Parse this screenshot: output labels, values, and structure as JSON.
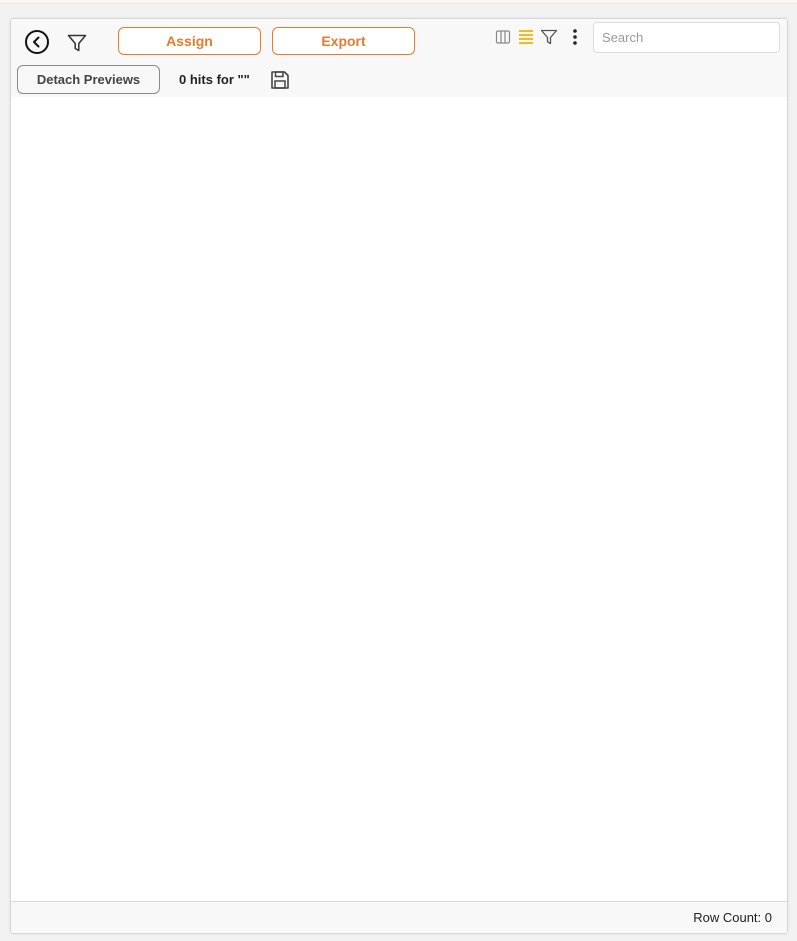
{
  "toolbar": {
    "back_icon": "arrow-left-circle-icon",
    "filter_icon": "funnel-icon",
    "assign_label": "Assign",
    "export_label": "Export",
    "columns_icon": "columns-icon",
    "list_icon": "list-icon",
    "more_icon": "vertical-ellipsis-icon",
    "search_placeholder": "Search",
    "search_value": "",
    "detach_label": "Detach Previews",
    "hits_text": "0 hits for \"\"",
    "save_icon": "floppy-disk-icon"
  },
  "footer": {
    "row_count_text": "Row Count: 0"
  },
  "colors": {
    "accent": "#e57c2e",
    "list_icon_active": "#f0b400",
    "icon_gray": "#777777"
  }
}
